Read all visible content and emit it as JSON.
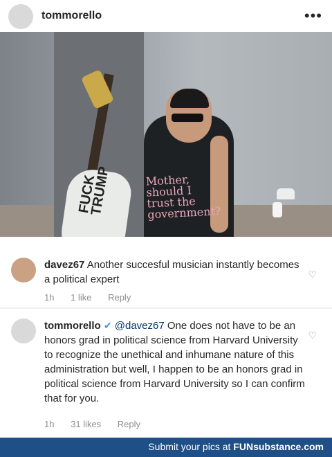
{
  "post": {
    "username": "tommorello",
    "more_icon": "more-icon"
  },
  "photo": {
    "guitar_text": "FUCK TRUMP",
    "shirt_text": "Mother, should I trust the government?"
  },
  "comments": [
    {
      "username": "davez67",
      "text": "Another succesful musician instantly becomes a political expert",
      "time": "1h",
      "likes": "1 like",
      "reply": "Reply"
    },
    {
      "username": "tommorello",
      "verified_icon": "verified-badge-icon",
      "mention": "@davez67",
      "text": "One does not have to be an honors grad in political science from Harvard University to recognize the unethical and inhumane nature of this administration but well, I happen to be an honors grad in political science from Harvard University so I can confirm that for you.",
      "time": "1h",
      "likes": "31 likes",
      "reply": "Reply"
    }
  ],
  "footer": {
    "text": "Submit your pics at",
    "brand": "FUNsubstance.com"
  },
  "colors": {
    "footer_bg": "#1e4f87",
    "verified": "#3897f0",
    "mention": "#003569"
  }
}
